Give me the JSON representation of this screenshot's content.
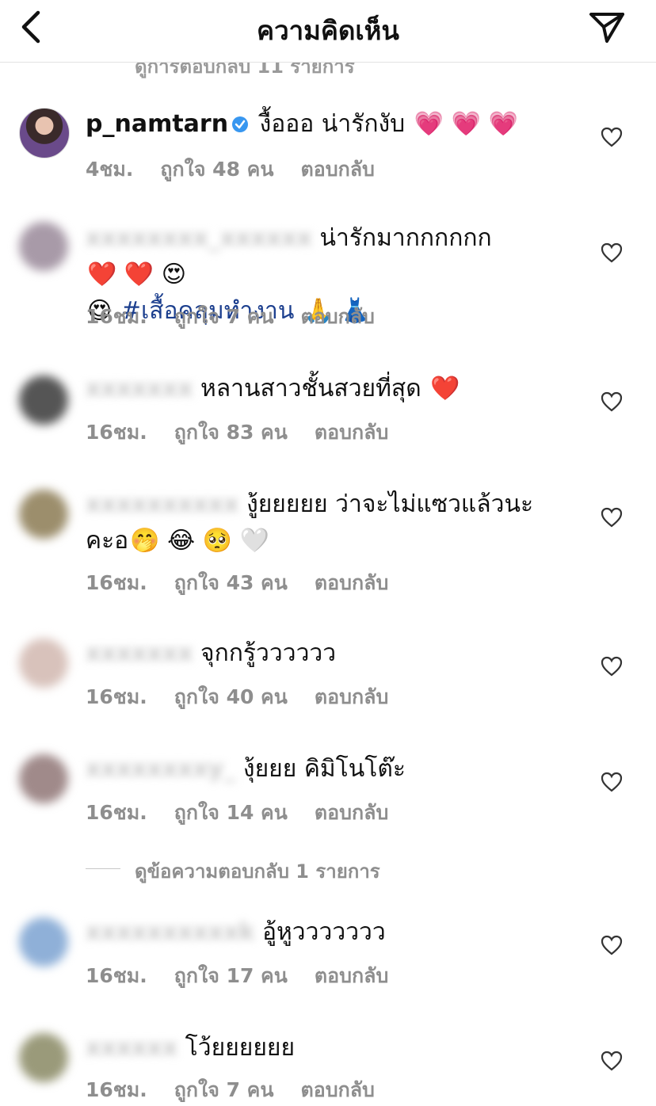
{
  "header": {
    "title": "ความคิดเห็น"
  },
  "top_cut": "ดูการตอบกลับ 11 รายการ",
  "comments": [
    {
      "user": "p_namtarn",
      "text": "งื้อออ น่ารักงับ",
      "emoji": "💗 💗 💗",
      "time": "4ชม.",
      "likes": "ถูกใจ 48 คน",
      "reply": "ตอบกลับ"
    },
    {
      "user": "xxxxxxxx_xxxxxx",
      "text": "น่ารักมากกกกกก",
      "emoji": "❤️ ❤️ 😍",
      "line2_emoji": "😍",
      "hashtag": "#เสื้อคลุมทำงาน",
      "line2_tail": "🙏 👗",
      "time": "16ชม.",
      "likes": "ถูกใจ 7 คน",
      "reply": "ตอบกลับ"
    },
    {
      "user": "xxxxxxx",
      "text": "หลานสาวชั้นสวยที่สุด",
      "emoji": "❤️",
      "time": "16ชม.",
      "likes": "ถูกใจ 83 คน",
      "reply": "ตอบกลับ"
    },
    {
      "user": "xxxxxxxxxx",
      "text": "งู้ยยยยย ว่าจะไม่แซวแล้วนะ",
      "line2": "คะอ",
      "line2_tail": "🤭 😂 🥺 🤍",
      "time": "16ชม.",
      "likes": "ถูกใจ 43 คน",
      "reply": "ตอบกลับ"
    },
    {
      "user": "xxxxxxx",
      "text": "จุกกรู้วววววว",
      "time": "16ชม.",
      "likes": "ถูกใจ 40 คน",
      "reply": "ตอบกลับ"
    },
    {
      "user": "xxxxxxxxy_",
      "text": "งุ้ยยย คิมิโนโต๊ะ",
      "time": "16ชม.",
      "likes": "ถูกใจ 14 คน",
      "reply": "ตอบกลับ"
    },
    {
      "user": "xxxxxxxxxxk",
      "text": "อู้หูววววววว",
      "time": "16ชม.",
      "likes": "ถูกใจ 17 คน",
      "reply": "ตอบกลับ"
    },
    {
      "user": "xxxxxx",
      "text": "โว้ยยยยยย",
      "time": "16ชม.",
      "likes": "ถูกใจ 7 คน",
      "reply": "ตอบกลับ"
    }
  ],
  "view_replies": "ดูข้อความตอบกลับ 1 รายการ",
  "colors": {
    "hashtag": "#1c3f8e",
    "verified": "#3897f0",
    "muted": "#8e8e8e"
  }
}
